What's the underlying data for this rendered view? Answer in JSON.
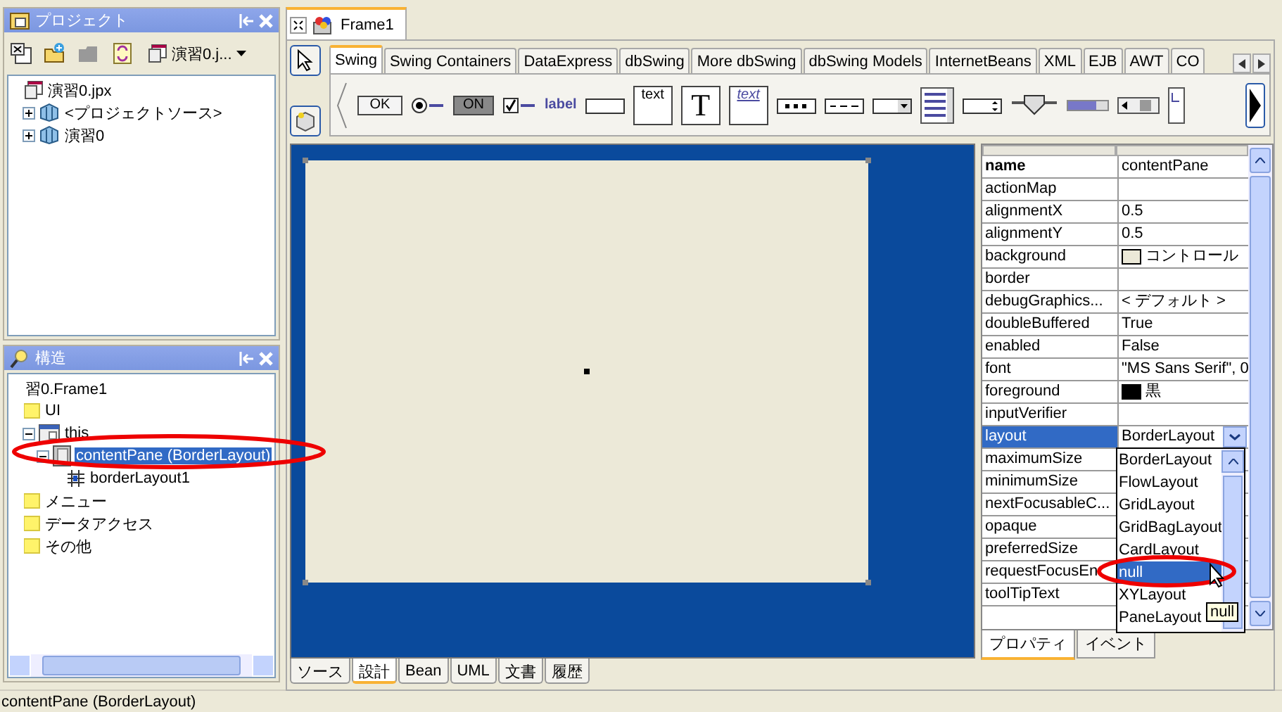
{
  "project_panel": {
    "title": "プロジェクト",
    "project_selector": "演習0.j...",
    "tree": [
      {
        "label": "演習0.jpx",
        "kind": "project",
        "selected": false,
        "children": [
          {
            "label": "<プロジェクトソース>",
            "kind": "package",
            "selected": false,
            "expanded": false
          },
          {
            "label": "演習0",
            "kind": "package",
            "selected": false,
            "expanded": false
          }
        ]
      }
    ]
  },
  "structure_panel": {
    "title": "構造",
    "tree": [
      {
        "label": "習0.Frame1",
        "kind": "plain",
        "selected": false
      },
      {
        "label": "UI",
        "kind": "folder",
        "selected": false,
        "children": [
          {
            "label": "this",
            "kind": "frame",
            "selected": false,
            "expanded": true,
            "children": [
              {
                "label": "contentPane (BorderLayout)",
                "kind": "panel",
                "selected": true,
                "expanded": true,
                "children": [
                  {
                    "label": "borderLayout1",
                    "kind": "layout",
                    "selected": false
                  }
                ]
              }
            ]
          }
        ]
      },
      {
        "label": "メニュー",
        "kind": "folder",
        "selected": false
      },
      {
        "label": "データアクセス",
        "kind": "folder",
        "selected": false
      },
      {
        "label": "その他",
        "kind": "folder",
        "selected": false
      }
    ]
  },
  "editor_tab": {
    "label": "Frame1"
  },
  "palette": {
    "tabs": [
      {
        "label": "Swing",
        "selected": true
      },
      {
        "label": "Swing Containers",
        "selected": false
      },
      {
        "label": "DataExpress",
        "selected": false
      },
      {
        "label": "dbSwing",
        "selected": false
      },
      {
        "label": "More dbSwing",
        "selected": false
      },
      {
        "label": "dbSwing Models",
        "selected": false
      },
      {
        "label": "InternetBeans",
        "selected": false
      },
      {
        "label": "XML",
        "selected": false
      },
      {
        "label": "EJB",
        "selected": false
      },
      {
        "label": "AWT",
        "selected": false
      },
      {
        "label": "CO",
        "selected": false
      }
    ],
    "items": [
      {
        "kind": "button",
        "text": "OK"
      },
      {
        "kind": "radio"
      },
      {
        "kind": "toggle",
        "text": "ON"
      },
      {
        "kind": "checkbox"
      },
      {
        "kind": "label",
        "text": "label"
      },
      {
        "kind": "textfield"
      },
      {
        "kind": "textarea",
        "text": "text"
      },
      {
        "kind": "textpane",
        "text": "T"
      },
      {
        "kind": "editorpane",
        "text": "text"
      },
      {
        "kind": "password"
      },
      {
        "kind": "formatted"
      },
      {
        "kind": "combo"
      },
      {
        "kind": "list"
      },
      {
        "kind": "spinner"
      },
      {
        "kind": "slider"
      },
      {
        "kind": "progress"
      },
      {
        "kind": "scrollbar"
      },
      {
        "kind": "tree"
      }
    ]
  },
  "inspector": {
    "rows": [
      {
        "name": "name",
        "value": "contentPane",
        "kind": "text",
        "bold": true,
        "selected": false
      },
      {
        "name": "actionMap",
        "kind": "empty",
        "bold": false,
        "selected": false
      },
      {
        "name": "alignmentX",
        "value": "0.5",
        "kind": "text",
        "bold": false,
        "selected": false
      },
      {
        "name": "alignmentY",
        "value": "0.5",
        "kind": "text",
        "bold": false,
        "selected": false
      },
      {
        "name": "background",
        "value": "コントロール",
        "kind": "color",
        "color": "#ece9d8",
        "bold": false,
        "selected": false
      },
      {
        "name": "border",
        "kind": "empty",
        "bold": false,
        "selected": false
      },
      {
        "name": "debugGraphics...",
        "value": "< デフォルト >",
        "kind": "text",
        "bold": false,
        "selected": false
      },
      {
        "name": "doubleBuffered",
        "value": "True",
        "kind": "text",
        "bold": false,
        "selected": false
      },
      {
        "name": "enabled",
        "value": "False",
        "kind": "text",
        "bold": false,
        "selected": false
      },
      {
        "name": "font",
        "value": "\"MS Sans Serif\", 0",
        "kind": "text",
        "bold": false,
        "selected": false
      },
      {
        "name": "foreground",
        "value": "黒",
        "kind": "color",
        "color": "#000000",
        "bold": false,
        "selected": false
      },
      {
        "name": "inputVerifier",
        "kind": "empty",
        "bold": false,
        "selected": false
      },
      {
        "name": "layout",
        "value": "BorderLayout",
        "kind": "dropdown",
        "bold": false,
        "selected": true
      },
      {
        "name": "maximumSize",
        "kind": "empty",
        "bold": false,
        "selected": false
      },
      {
        "name": "minimumSize",
        "kind": "empty",
        "bold": false,
        "selected": false
      },
      {
        "name": "nextFocusableC...",
        "kind": "empty",
        "bold": false,
        "selected": false
      },
      {
        "name": "opaque",
        "kind": "empty",
        "bold": false,
        "selected": false
      },
      {
        "name": "preferredSize",
        "kind": "empty",
        "bold": false,
        "selected": false
      },
      {
        "name": "requestFocusEn",
        "kind": "empty",
        "bold": false,
        "selected": false
      },
      {
        "name": "toolTipText",
        "kind": "empty",
        "bold": false,
        "selected": false
      }
    ],
    "dropdown": {
      "options": [
        {
          "label": "BorderLayout",
          "selected": false
        },
        {
          "label": "FlowLayout",
          "selected": false
        },
        {
          "label": "GridLayout",
          "selected": false
        },
        {
          "label": "GridBagLayout",
          "selected": false
        },
        {
          "label": "CardLayout",
          "selected": false
        },
        {
          "label": "null",
          "selected": true
        },
        {
          "label": "XYLayout",
          "selected": false
        },
        {
          "label": "PaneLayout",
          "selected": false
        }
      ],
      "tooltip": "null"
    },
    "tabs": [
      {
        "label": "プロパティ",
        "selected": true
      },
      {
        "label": "イベント",
        "selected": false
      }
    ]
  },
  "view_tabs": [
    {
      "label": "ソース",
      "selected": false
    },
    {
      "label": "設計",
      "selected": true
    },
    {
      "label": "Bean",
      "selected": false
    },
    {
      "label": "UML",
      "selected": false
    },
    {
      "label": "文書",
      "selected": false
    },
    {
      "label": "履歴",
      "selected": false
    }
  ],
  "status_bar": {
    "text": "contentPane (BorderLayout)"
  }
}
